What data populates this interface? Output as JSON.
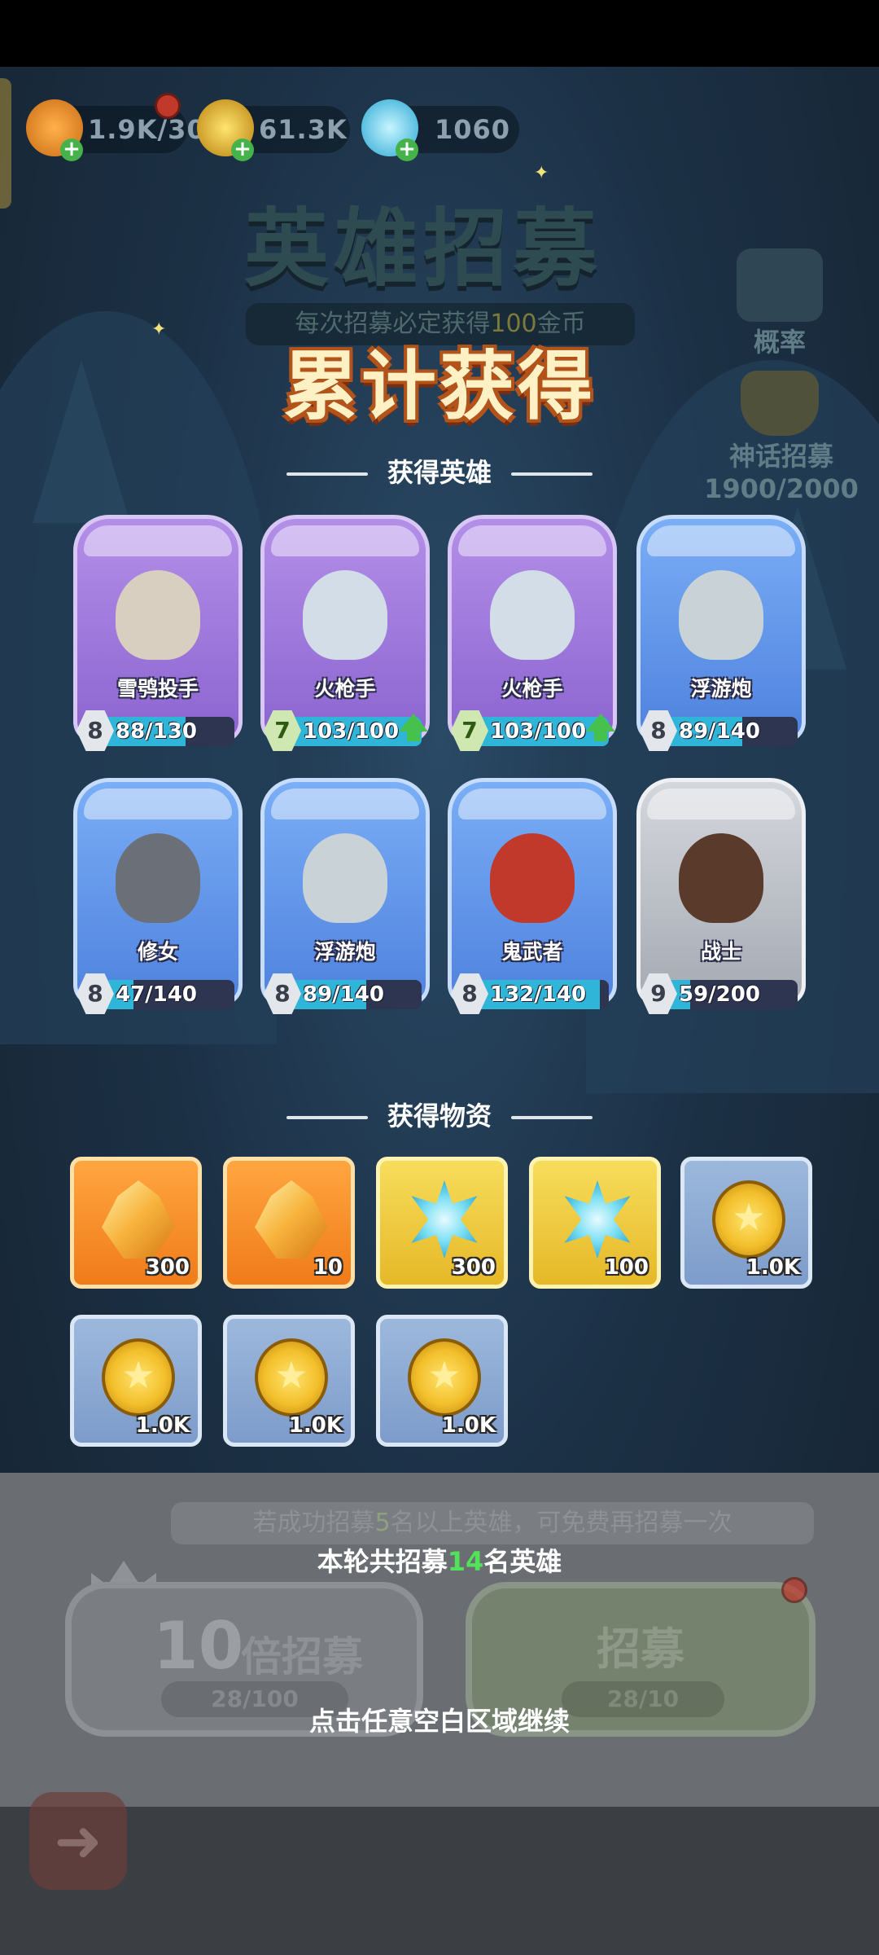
{
  "resources": [
    {
      "name": "stamina",
      "value": "1.9K/30"
    },
    {
      "name": "gold",
      "value": "61.3K"
    },
    {
      "name": "gems",
      "value": "1060"
    }
  ],
  "background": {
    "title": "英雄招募",
    "subtitle_prefix": "每次招募必定获得",
    "subtitle_amount": "100",
    "subtitle_suffix": "金币",
    "probability_label": "概率",
    "myth_label": "神话招募",
    "myth_progress": "1900/2000"
  },
  "main_title": "累计获得",
  "heroes_section_title": "获得英雄",
  "heroes": [
    {
      "name": "雪鸮投手",
      "level": "8",
      "count": "88/130",
      "progress": 0.68,
      "rarity": "purple",
      "upgrade": false
    },
    {
      "name": "火枪手",
      "level": "7",
      "count": "103/100",
      "progress": 1.0,
      "rarity": "purple",
      "upgrade": true
    },
    {
      "name": "火枪手",
      "level": "7",
      "count": "103/100",
      "progress": 1.0,
      "rarity": "purple",
      "upgrade": true
    },
    {
      "name": "浮游炮",
      "level": "8",
      "count": "89/140",
      "progress": 0.64,
      "rarity": "blue",
      "upgrade": false
    },
    {
      "name": "修女",
      "level": "8",
      "count": "47/140",
      "progress": 0.34,
      "rarity": "blue",
      "upgrade": false
    },
    {
      "name": "浮游炮",
      "level": "8",
      "count": "89/140",
      "progress": 0.64,
      "rarity": "blue",
      "upgrade": false
    },
    {
      "name": "鬼武者",
      "level": "8",
      "count": "132/140",
      "progress": 0.94,
      "rarity": "blue",
      "upgrade": false
    },
    {
      "name": "战士",
      "level": "9",
      "count": "59/200",
      "progress": 0.3,
      "rarity": "grey",
      "upgrade": false
    }
  ],
  "items_section_title": "获得物资",
  "items": [
    {
      "type": "crystal",
      "qty": "300",
      "bg": "orange"
    },
    {
      "type": "crystal",
      "qty": "10",
      "bg": "orange"
    },
    {
      "type": "ice",
      "qty": "300",
      "bg": "yellow"
    },
    {
      "type": "ice",
      "qty": "100",
      "bg": "yellow"
    },
    {
      "type": "coin",
      "qty": "1.0K",
      "bg": "lblue"
    },
    {
      "type": "coin",
      "qty": "1.0K",
      "bg": "lblue"
    },
    {
      "type": "coin",
      "qty": "1.0K",
      "bg": "lblue"
    },
    {
      "type": "coin",
      "qty": "1.0K",
      "bg": "lblue"
    }
  ],
  "hint": {
    "prefix": "若成功招募",
    "num": "5",
    "suffix": "名以上英雄，可免费再招募一次"
  },
  "round": {
    "prefix": "本轮共招募",
    "num": "14",
    "suffix": "名英雄"
  },
  "buttons": {
    "ten_big": "10",
    "ten_label": "倍招募",
    "ten_cost": "28/100",
    "one_label": "招募",
    "one_cost": "28/10"
  },
  "continue_text": "点击任意空白区域继续",
  "colors": {
    "upgrade": "#46c14e",
    "title_outline": "#b3531a",
    "count_highlight": "#52e25a"
  }
}
